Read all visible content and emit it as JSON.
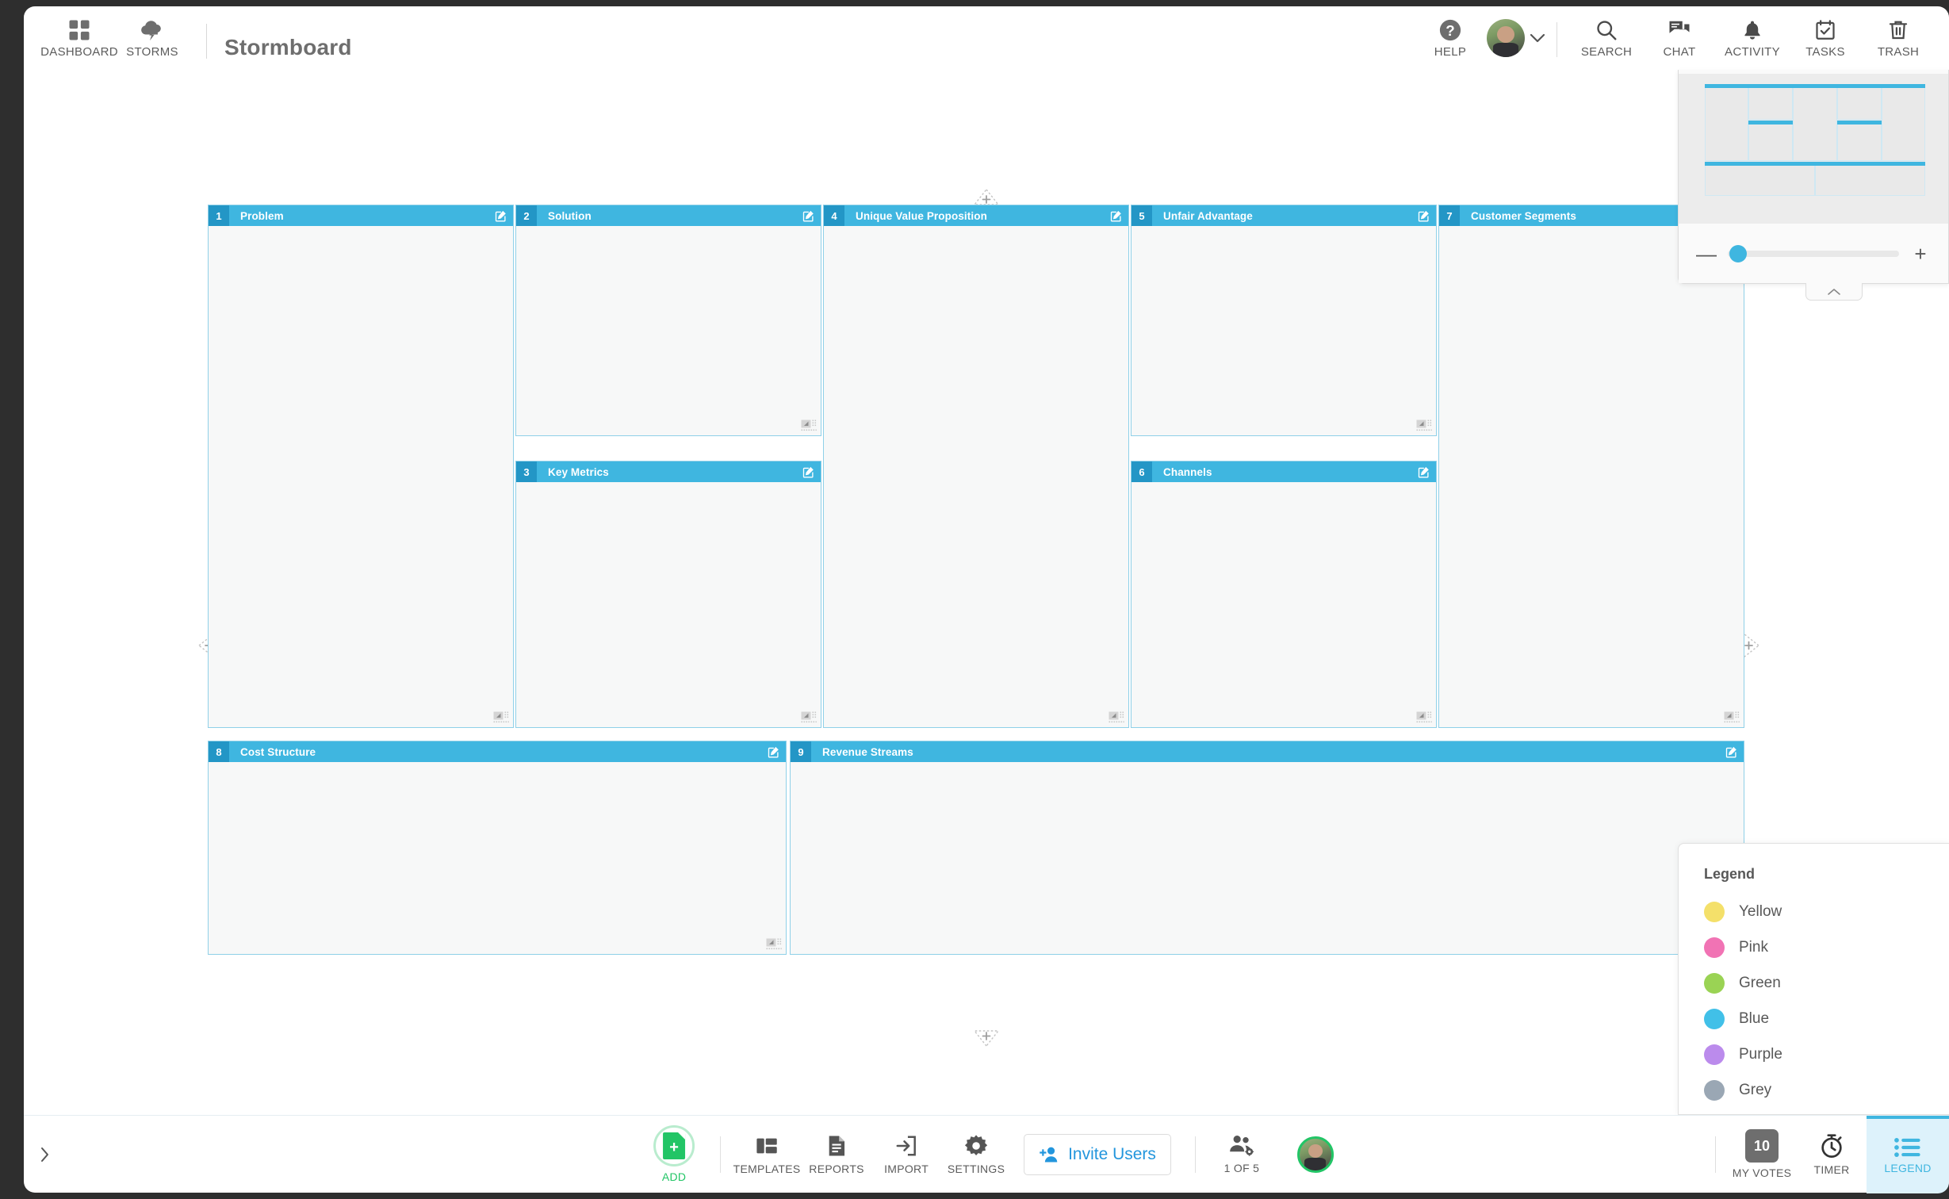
{
  "header": {
    "nav": [
      {
        "label": "DASHBOARD",
        "icon": "grid-icon"
      },
      {
        "label": "STORMS",
        "icon": "storm-cloud-icon"
      }
    ],
    "app_title": "Stormboard",
    "right_items": [
      {
        "label": "HELP",
        "icon": "help-icon"
      },
      {
        "label": "SEARCH",
        "icon": "search-icon"
      },
      {
        "label": "CHAT",
        "icon": "chat-icon"
      },
      {
        "label": "ACTIVITY",
        "icon": "bell-icon"
      },
      {
        "label": "TASKS",
        "icon": "tasks-icon"
      },
      {
        "label": "TRASH",
        "icon": "trash-icon"
      }
    ],
    "account_chevron": "chevron-down-icon"
  },
  "board": {
    "title": "Stormboard",
    "accent_color": "#3fb6e0",
    "number_badge_color": "#2396c6",
    "card_border_color": "#8fd0e8",
    "card_fill_color": "#f7f8f8",
    "cards": [
      {
        "number": "1",
        "title": "Problem",
        "edit_icon": "edit-icon",
        "resize_icon": "resize-handle-icon"
      },
      {
        "number": "2",
        "title": "Solution",
        "edit_icon": "edit-icon",
        "resize_icon": "resize-handle-icon"
      },
      {
        "number": "3",
        "title": "Key Metrics",
        "edit_icon": "edit-icon",
        "resize_icon": "resize-handle-icon"
      },
      {
        "number": "4",
        "title": "Unique Value Proposition",
        "edit_icon": "edit-icon",
        "resize_icon": "resize-handle-icon"
      },
      {
        "number": "5",
        "title": "Unfair Advantage",
        "edit_icon": "edit-icon",
        "resize_icon": "resize-handle-icon"
      },
      {
        "number": "6",
        "title": "Channels",
        "edit_icon": "edit-icon",
        "resize_icon": "resize-handle-icon"
      },
      {
        "number": "7",
        "title": "Customer Segments",
        "edit_icon": "edit-icon",
        "resize_icon": "resize-handle-icon"
      },
      {
        "number": "8",
        "title": "Cost Structure",
        "edit_icon": "edit-icon",
        "resize_icon": "resize-handle-icon"
      },
      {
        "number": "9",
        "title": "Revenue Streams",
        "edit_icon": "edit-icon",
        "resize_icon": "resize-handle-icon"
      }
    ],
    "add_handles": [
      {
        "name": "add-column-top",
        "icon": "triangle-plus-up-icon"
      },
      {
        "name": "add-column-left",
        "icon": "triangle-plus-left-icon"
      },
      {
        "name": "add-column-right",
        "icon": "triangle-plus-right-icon"
      },
      {
        "name": "add-column-bottom",
        "icon": "triangle-plus-down-icon"
      }
    ]
  },
  "minimap": {
    "collapse_icon": "chevron-up-icon",
    "zoom_out_icon": "minus-icon",
    "zoom_in_icon": "plus-icon",
    "zoom_value": 6
  },
  "legend": {
    "title": "Legend",
    "items": [
      {
        "label": "Yellow",
        "color": "#f4e06a"
      },
      {
        "label": "Pink",
        "color": "#f173b4"
      },
      {
        "label": "Green",
        "color": "#9ad354"
      },
      {
        "label": "Blue",
        "color": "#41c0e8"
      },
      {
        "label": "Purple",
        "color": "#bb8bec"
      },
      {
        "label": "Grey",
        "color": "#9aa7b4"
      }
    ]
  },
  "footer": {
    "expand_icon": "chevron-right-icon",
    "add": {
      "label": "ADD",
      "icon": "add-sticky-icon",
      "color": "#22c566"
    },
    "tools": [
      {
        "label": "TEMPLATES",
        "icon": "templates-icon"
      },
      {
        "label": "REPORTS",
        "icon": "report-icon"
      },
      {
        "label": "IMPORT",
        "icon": "import-icon"
      },
      {
        "label": "SETTINGS",
        "icon": "gear-icon"
      }
    ],
    "invite": {
      "label": "Invite Users",
      "icon": "add-user-icon",
      "color": "#2396dd"
    },
    "users": {
      "label": "1 OF 5",
      "icon": "manage-users-icon"
    },
    "right": [
      {
        "label": "MY VOTES",
        "icon": "votes-badge-icon",
        "value": "10"
      },
      {
        "label": "TIMER",
        "icon": "stopwatch-icon"
      },
      {
        "label": "LEGEND",
        "icon": "list-icon",
        "active": true
      }
    ]
  }
}
